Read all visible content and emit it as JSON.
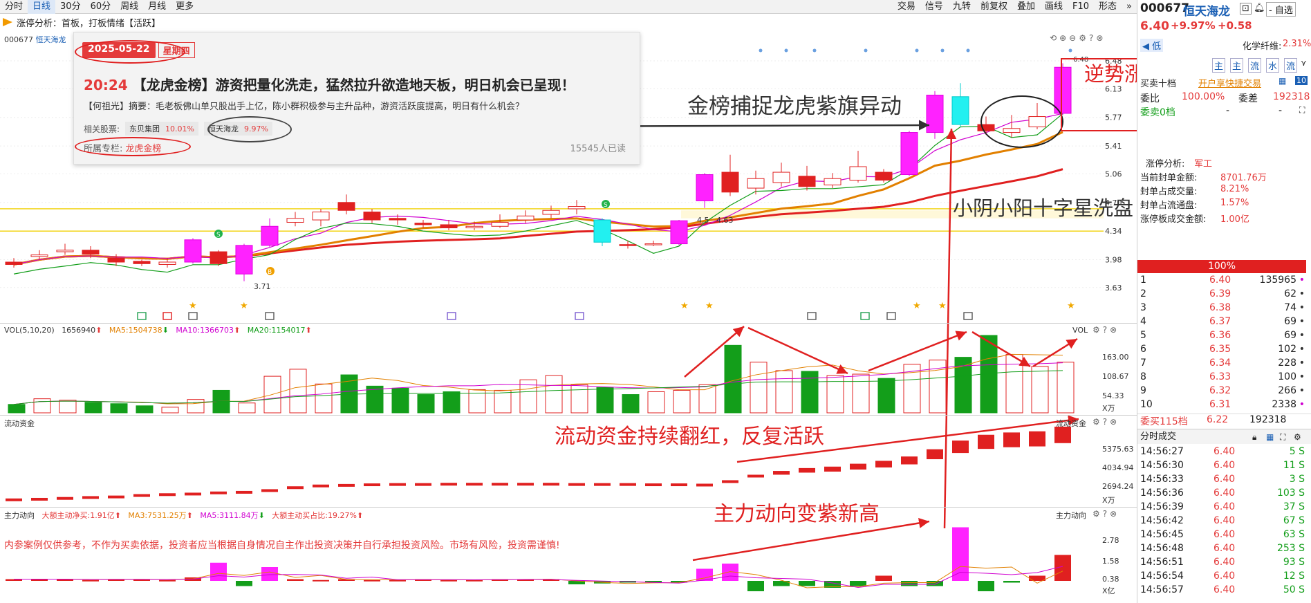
{
  "toolbar": {
    "left": [
      "分时",
      "日线",
      "30分",
      "60分",
      "周线",
      "月线",
      "更多"
    ],
    "active": 1,
    "right": [
      "交易",
      "信号",
      "九转",
      "前复权",
      "叠加",
      "画线",
      "F10",
      "形态"
    ]
  },
  "subbar": {
    "text": "涨停分析：首板，打板情绪【活跃】"
  },
  "stock": {
    "code": "000677",
    "name": "恒天海龙",
    "price": "6.40",
    "pct": "+9.97%",
    "chg": "+0.58",
    "tag": "低",
    "extra_label": "化学纤维:",
    "extra_val": "2.31%",
    "self_select": "- 自选"
  },
  "price_axis": [
    "6.48",
    "6.13",
    "5.77",
    "5.41",
    "5.06",
    "4.70",
    "4.34",
    "3.98",
    "3.63"
  ],
  "price_marks": {
    "low": "3.71",
    "b_label": "B",
    "s_label": "S",
    "mid1": "4.5",
    "mid2": "4.63",
    "top": "6.48"
  },
  "vol_header": {
    "title": "VOL(5,10,20)",
    "v": "1656940",
    "ma5": "MA5:1504738",
    "ma10": "MA10:1366703",
    "ma20": "MA20:1154017",
    "right": "VOL"
  },
  "vol_axis": [
    "163.00",
    "108.67",
    "54.33",
    "X万"
  ],
  "flow_header": {
    "title": "流动资金",
    "right": "流动资金"
  },
  "flow_axis": [
    "5375.63",
    "4034.94",
    "2694.24",
    "X万"
  ],
  "main_header": {
    "title": "主力动向",
    "a": "大额主动净买:1.91亿",
    "b": "MA3:7531.25万",
    "c": "MA5:3111.84万",
    "d": "大额主动买占比:19.27%",
    "right": "主力动向"
  },
  "main_axis": [
    "2.78",
    "1.58",
    "0.38",
    "X亿"
  ],
  "warning": "内参案例仅供参考，不作为买卖依据，投资者应当根据自身情况自主作出投资决策并自行承担投资风险。市场有风险，投资需谨慎!",
  "popup": {
    "date": "2025-05-22",
    "weekday": "星期四",
    "time": "20:24",
    "title": "【龙虎金榜】游资把量化洗走，猛然拉升欲造地天板，明日机会已呈现！",
    "abstract": "【何祖光】摘要：毛老板佛山单只股出手上亿，陈小群积极参与主升品种，游资活跃度提高，明日有什么机会？",
    "related_label": "相关股票:",
    "stocks": [
      {
        "name": "东贝集团",
        "pct": "10.01%"
      },
      {
        "name": "恒天海龙",
        "pct": "9.97%"
      }
    ],
    "column_label": "所属专栏:",
    "column": "龙虎金榜",
    "reads": "15545人已读"
  },
  "annotations": {
    "a1": "金榜捕捉龙虎紫旗异动",
    "a2": "逆势涨停新高",
    "a3": "小阴小阳十字星洗盘",
    "a4": "流动资金持续翻红，反复活跃",
    "a5": "主力动向变紫新高"
  },
  "right": {
    "tabs": [
      "主",
      "主",
      "流",
      "水",
      "流"
    ],
    "buysell": "买卖十档",
    "open": "开户享快捷交易",
    "wb_label": "委比",
    "wb": "100.00%",
    "wc_label": "委差",
    "wc": "192318",
    "ws": "委卖0档",
    "dash": "-",
    "stats": [
      {
        "k": "涨停分析:",
        "v": "军工"
      },
      {
        "k": "当前封单金额:",
        "v": "8701.76万"
      },
      {
        "k": "封单占成交量:",
        "v": "8.21%"
      },
      {
        "k": "封单占流通盘:",
        "v": "1.57%"
      },
      {
        "k": "涨停板成交金额:",
        "v": "1.00亿"
      }
    ],
    "bar": "100%",
    "book": [
      {
        "n": "1",
        "p": "6.40",
        "q": "135965"
      },
      {
        "n": "2",
        "p": "6.39",
        "q": "62"
      },
      {
        "n": "3",
        "p": "6.38",
        "q": "74"
      },
      {
        "n": "4",
        "p": "6.37",
        "q": "69"
      },
      {
        "n": "5",
        "p": "6.36",
        "q": "69"
      },
      {
        "n": "6",
        "p": "6.35",
        "q": "102"
      },
      {
        "n": "7",
        "p": "6.34",
        "q": "228"
      },
      {
        "n": "8",
        "p": "6.33",
        "q": "100"
      },
      {
        "n": "9",
        "p": "6.32",
        "q": "266"
      },
      {
        "n": "10",
        "p": "6.31",
        "q": "2338"
      }
    ],
    "wm_label": "委买115档",
    "wm_p": "6.22",
    "wm_q": "192318",
    "ticks_title": "分时成交",
    "ticks": [
      {
        "t": "14:56:27",
        "p": "6.40",
        "v": "5 S"
      },
      {
        "t": "14:56:30",
        "p": "6.40",
        "v": "11 S"
      },
      {
        "t": "14:56:33",
        "p": "6.40",
        "v": "3 S"
      },
      {
        "t": "14:56:36",
        "p": "6.40",
        "v": "103 S"
      },
      {
        "t": "14:56:39",
        "p": "6.40",
        "v": "37 S"
      },
      {
        "t": "14:56:42",
        "p": "6.40",
        "v": "67 S"
      },
      {
        "t": "14:56:45",
        "p": "6.40",
        "v": "63 S"
      },
      {
        "t": "14:56:48",
        "p": "6.40",
        "v": "253 S"
      },
      {
        "t": "14:56:51",
        "p": "6.40",
        "v": "93 S"
      },
      {
        "t": "14:56:54",
        "p": "6.40",
        "v": "12 S"
      },
      {
        "t": "14:56:57",
        "p": "6.40",
        "v": "50 S"
      }
    ]
  },
  "chart_data": {
    "type": "candlestick",
    "title": "000677 恒天海龙 日线",
    "candles": [
      [
        3.95,
        3.92,
        3.88,
        4.0
      ],
      [
        4.02,
        4.04,
        3.98,
        4.1
      ],
      [
        4.08,
        4.1,
        4.04,
        4.18
      ],
      [
        4.1,
        4.05,
        4.0,
        4.15
      ],
      [
        4.0,
        3.95,
        3.9,
        4.05
      ],
      [
        3.96,
        3.93,
        3.9,
        3.98
      ],
      [
        3.92,
        3.95,
        3.88,
        4.0
      ],
      [
        3.95,
        4.23,
        3.93,
        4.25
      ],
      [
        4.08,
        3.93,
        3.9,
        4.1
      ],
      [
        3.8,
        4.16,
        3.71,
        4.18
      ],
      [
        4.16,
        4.4,
        4.14,
        4.5
      ],
      [
        4.45,
        4.5,
        4.4,
        4.58
      ],
      [
        4.48,
        4.58,
        4.4,
        4.62
      ],
      [
        4.7,
        4.6,
        4.55,
        4.8
      ],
      [
        4.58,
        4.48,
        4.44,
        4.62
      ],
      [
        4.5,
        4.48,
        4.42,
        4.55
      ],
      [
        4.44,
        4.42,
        4.38,
        4.48
      ],
      [
        4.42,
        4.38,
        4.35,
        4.48
      ],
      [
        4.38,
        4.4,
        4.35,
        4.46
      ],
      [
        4.4,
        4.45,
        4.38,
        4.55
      ],
      [
        4.48,
        4.53,
        4.44,
        4.6
      ],
      [
        4.55,
        4.6,
        4.5,
        4.66
      ],
      [
        4.62,
        4.65,
        4.55,
        4.73
      ],
      [
        4.48,
        4.2,
        4.15,
        4.5
      ],
      [
        4.17,
        4.16,
        4.12,
        4.22
      ],
      [
        4.18,
        4.18,
        4.15,
        4.22
      ],
      [
        4.18,
        4.47,
        4.16,
        4.48
      ],
      [
        4.72,
        5.05,
        4.63,
        5.07
      ],
      [
        5.08,
        4.83,
        4.78,
        5.3
      ],
      [
        4.88,
        5.0,
        4.8,
        5.1
      ],
      [
        4.95,
        5.08,
        4.9,
        5.2
      ],
      [
        5.03,
        4.9,
        4.85,
        5.16
      ],
      [
        4.92,
        5.0,
        4.88,
        5.07
      ],
      [
        4.98,
        5.15,
        4.95,
        5.35
      ],
      [
        5.08,
        4.98,
        4.95,
        5.12
      ],
      [
        5.05,
        5.58,
        5.03,
        5.6
      ],
      [
        5.58,
        6.05,
        5.5,
        6.1
      ],
      [
        6.03,
        5.68,
        5.65,
        6.2
      ],
      [
        5.68,
        5.6,
        5.55,
        5.78
      ],
      [
        5.58,
        5.63,
        5.52,
        5.8
      ],
      [
        5.65,
        5.78,
        5.62,
        5.95
      ],
      [
        5.82,
        6.4,
        5.8,
        6.45
      ]
    ],
    "volume": [
      1.2,
      2.0,
      1.8,
      1.5,
      1.3,
      1.0,
      0.8,
      1.9,
      3.2,
      1.4,
      5.2,
      6.2,
      4.1,
      5.4,
      3.8,
      3.5,
      2.6,
      3.0,
      3.3,
      3.2,
      4.7,
      5.3,
      4.0,
      3.6,
      2.6,
      3.0,
      3.2,
      4.0,
      9.6,
      7.2,
      6.0,
      5.9,
      5.3,
      5.5,
      4.9,
      6.9,
      7.5,
      7.9,
      11.0,
      8.3,
      6.6,
      7.2
    ],
    "flow": [
      0.1,
      0.12,
      0.15,
      0.18,
      0.2,
      0.25,
      0.28,
      0.3,
      0.34,
      0.36,
      0.42,
      0.52,
      0.58,
      0.6,
      0.62,
      0.63,
      0.63,
      0.64,
      0.64,
      0.64,
      0.64,
      0.64,
      0.63,
      0.63,
      0.63,
      0.62,
      0.62,
      0.61,
      0.73,
      0.92,
      1.05,
      1.15,
      1.2,
      1.3,
      1.4,
      1.55,
      1.8,
      2.1,
      2.3,
      2.38,
      2.42,
      2.58
    ],
    "main_force": [
      0.1,
      0.1,
      0.1,
      0.05,
      0.1,
      0.1,
      0.05,
      0.2,
      1.05,
      -0.3,
      0.8,
      0.1,
      0.05,
      0.1,
      0.05,
      0.05,
      0.1,
      0.05,
      0.05,
      0.1,
      0.1,
      0.1,
      -0.2,
      -0.15,
      -0.1,
      -0.1,
      -0.1,
      0.7,
      1.0,
      -0.6,
      -0.3,
      -0.3,
      -0.4,
      -0.3,
      0.3,
      -0.3,
      -0.3,
      3.1,
      -0.6,
      -0.1,
      0.3,
      1.5
    ]
  }
}
